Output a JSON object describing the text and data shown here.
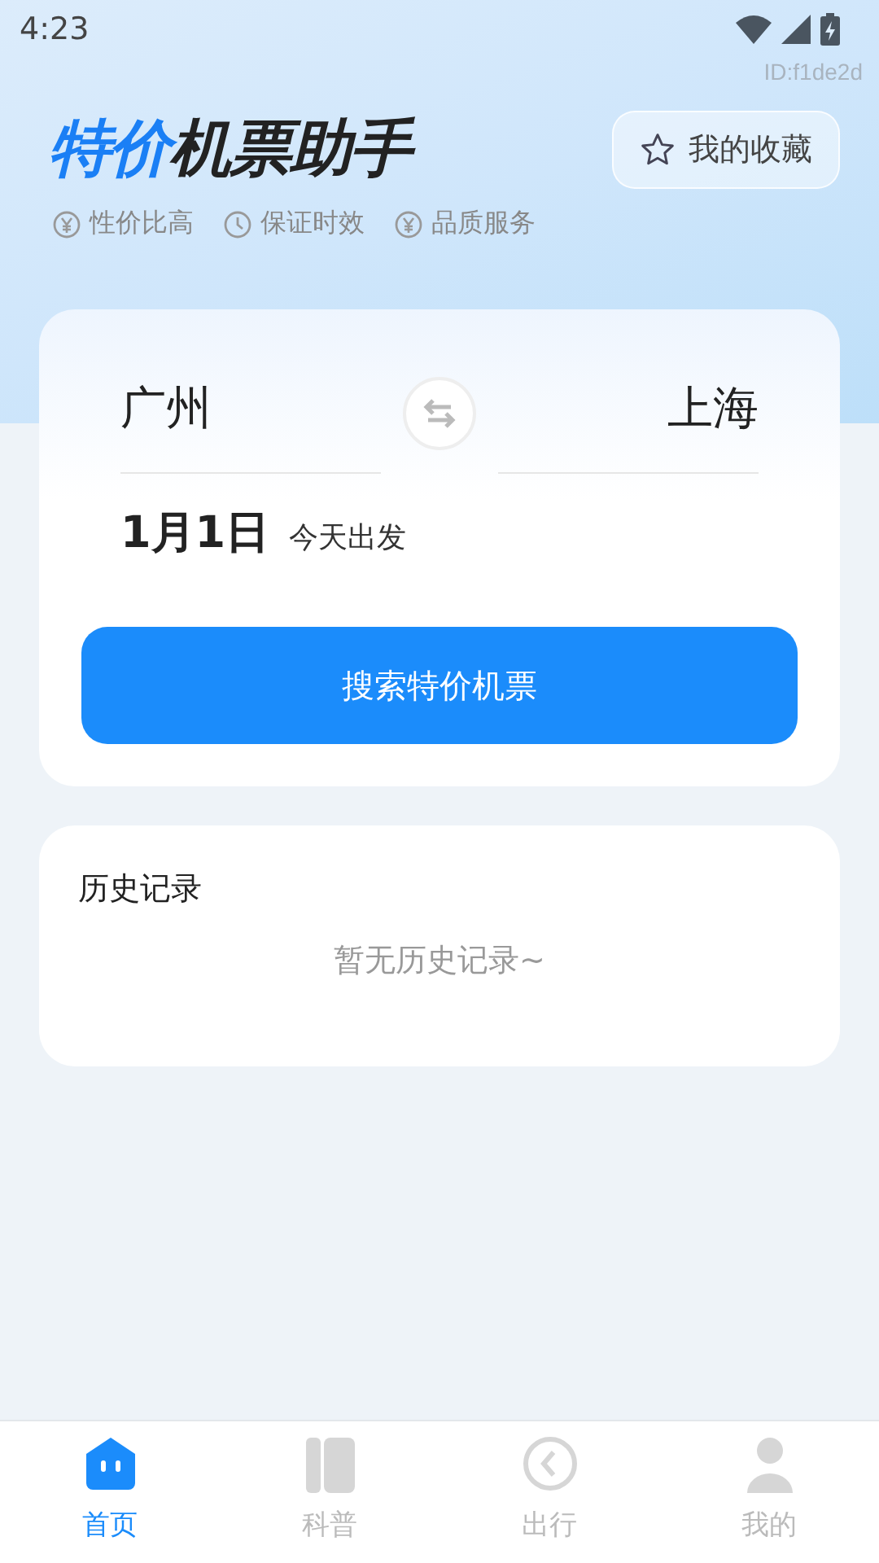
{
  "status_bar": {
    "time": "4:23"
  },
  "device_id": "ID:f1de2d",
  "title": {
    "highlight": "特价",
    "rest": "机票助手"
  },
  "favorites_button": {
    "label": "我的收藏"
  },
  "features": [
    {
      "kind": "yuan",
      "label": "性价比高"
    },
    {
      "kind": "clock",
      "label": "保证时效"
    },
    {
      "kind": "yuan",
      "label": "品质服务"
    }
  ],
  "search_card": {
    "from": "广州",
    "to": "上海",
    "date": "1月1日",
    "date_note": "今天出发",
    "button": "搜索特价机票"
  },
  "history": {
    "title": "历史记录",
    "empty": "暂无历史记录~"
  },
  "tabs": [
    {
      "kind": "home",
      "label": "首页",
      "selected": true
    },
    {
      "kind": "book",
      "label": "科普",
      "selected": false
    },
    {
      "kind": "trip",
      "label": "出行",
      "selected": false
    },
    {
      "kind": "user",
      "label": "我的",
      "selected": false
    }
  ]
}
